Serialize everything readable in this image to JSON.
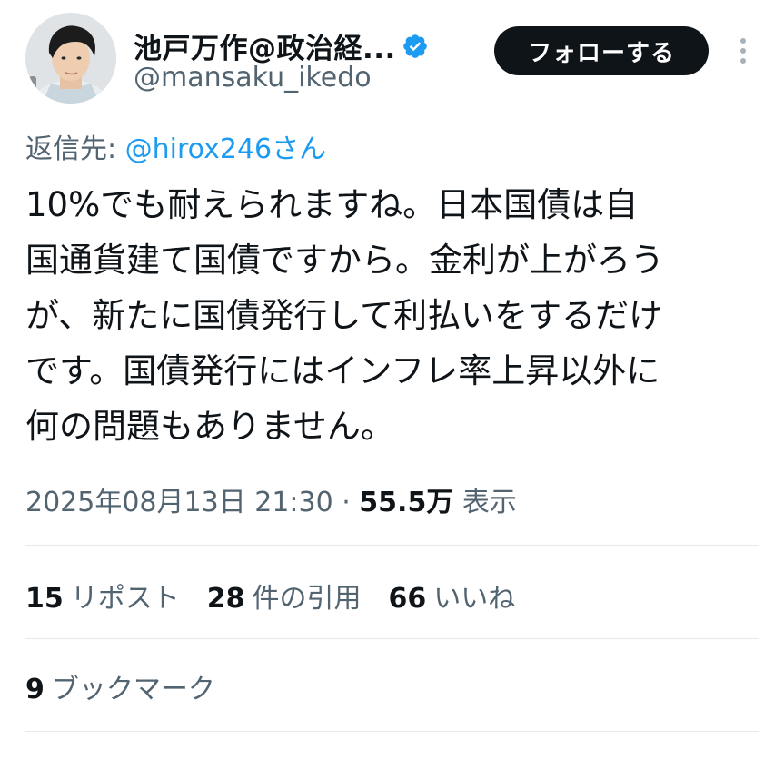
{
  "author": {
    "display_name": "池戸万作@政治経...",
    "handle": "@mansaku_ikedo",
    "verified": true
  },
  "actions": {
    "follow_label": "フォローする",
    "more_icon": "more-vertical-icon"
  },
  "reply": {
    "prefix": "返信先: ",
    "target": "@hirox246さん"
  },
  "tweet": {
    "lines": [
      "10%でも耐えられますね。日本国債は自",
      "国通貨建て国債ですから。金利が上がろう",
      "が、新たに国債発行して利払いをするだけ",
      "です。国債発行にはインフレ率上昇以外に",
      "何の問題もありません。"
    ]
  },
  "meta": {
    "timestamp": "2025年08月13日 21:30",
    "separator": " · ",
    "views": "55.5万",
    "views_label": " 表示"
  },
  "stats": {
    "reposts": {
      "count": "15",
      "label": "リポスト"
    },
    "quotes": {
      "count": "28",
      "label": "件の引用"
    },
    "likes": {
      "count": "66",
      "label": "いいね"
    },
    "bookmarks": {
      "count": "9",
      "label": "ブックマーク"
    }
  },
  "colors": {
    "text_primary": "#0f1419",
    "text_secondary": "#536471",
    "link": "#1d9bf0",
    "verified": "#1d9bf0",
    "follow_bg": "#0f1419",
    "divider": "#e6e9ec"
  }
}
